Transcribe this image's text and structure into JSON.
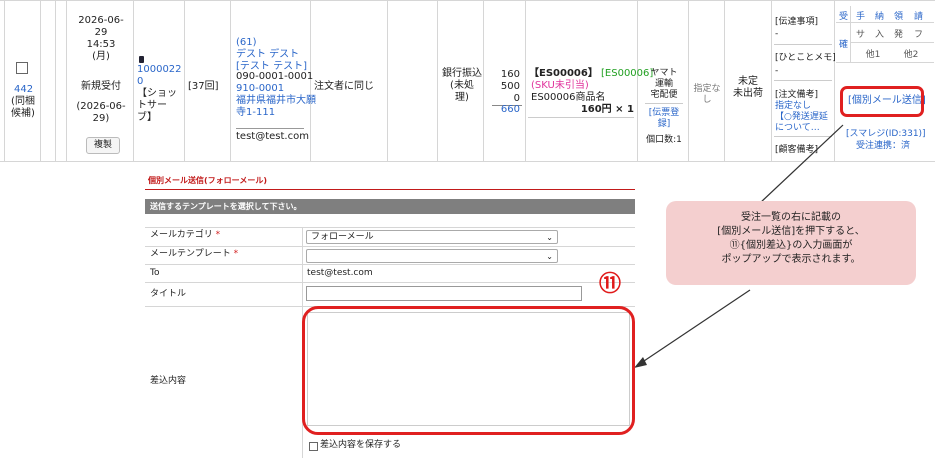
{
  "row": {
    "checkbox_checked": false,
    "order_link": "442",
    "order_note": "(同梱\n候補)",
    "date_block": "2026-06-\n29\n14:53\n(月)",
    "status": "新規受付",
    "date2": "(2026-06-\n29)",
    "copy_button": "複製",
    "shop_id": "1000022\n0",
    "shop_name": "【ショッ\nトサー\nブ】",
    "count": "[37回]",
    "customer_block": "(61)\nデスト デスト\n[テスト テスト]",
    "customer_phone": "090-0001-0001",
    "customer_address": "910-0001\n福井県福井市大願\n寺1-111",
    "customer_email": "test@test.com",
    "same_as_orderer": "注文者に同じ",
    "payment": "銀行振込\n(未処\n理)",
    "amounts": "160\n500\n0",
    "amount_total": "660",
    "item_code": "【ES00006】",
    "item_code2": "[ES00006]",
    "sku_warning": "(SKU未引当)",
    "item_name": "ES00006商品名",
    "item_price": "160円 × 1",
    "shipping": "ヤマト\n運輸\n宅配便",
    "slip_link": "[伝票登\n録]",
    "box_count": "個口数:1",
    "designation": "指定な\nし",
    "ship_status": "未定\n未出荷",
    "memo_label1": "[伝達事項]",
    "memo_val1": "-",
    "memo_label2": "[ひとことメモ]",
    "memo_val2": "-",
    "memo_label3": "[注文備考]",
    "memo_val3": "指定なし",
    "memo_val3b": "【○発送遅延\nについて…",
    "memo_label4": "[顧客備考]",
    "flags_row1": [
      "受",
      "手",
      "納",
      "領",
      "請"
    ],
    "flags_row2_left": "確",
    "flags_row2": [
      "サ",
      "入",
      "発",
      "フ"
    ],
    "flags_row3": [
      "他1",
      "他2"
    ],
    "mail_button": "[個別メール送信]",
    "smaregi": "[スマレジ(ID:331)]",
    "order_link_status": "受注連携：済"
  },
  "callout": {
    "text": "受注一覧の右に記載の\n[個別メール送信]を押下すると、\n⑪{個別差込}の入力画面が\nポップアップで表示されます。",
    "color": "#f4cfcf"
  },
  "marker": "⑪",
  "form": {
    "title": "個別メール送信(フォローメール)",
    "instruction": "送信するテンプレートを選択して下さい。",
    "category_label": "メールカテゴリ",
    "category_value": "フォローメール",
    "template_label": "メールテンプレート",
    "template_value": "",
    "required_mark": "*",
    "to_label": "To",
    "to_value": "test@test.com",
    "title_label": "タイトル",
    "title_value": "",
    "body_label": "差込内容",
    "body_value": "",
    "save_checkbox_label": "差込内容を保存する",
    "save_checked": false
  }
}
